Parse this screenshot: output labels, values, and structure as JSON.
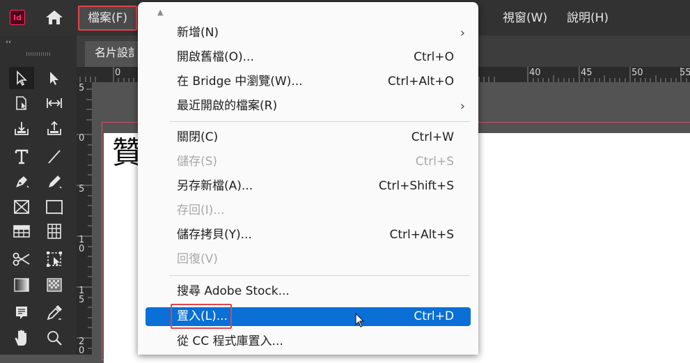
{
  "app": {
    "logo_text": "Id"
  },
  "menubar": {
    "file": "檔案(F)",
    "partial": ")",
    "view": "視窗(W)",
    "help": "說明(H)"
  },
  "toolpanel": {
    "collapse": "‹‹"
  },
  "document": {
    "tab_label": "名片設訁"
  },
  "rulers": {
    "horizontal": [
      "0",
      "40",
      "45",
      "50",
      "55"
    ],
    "vertical": [
      "5",
      "0",
      "5",
      "1\n0",
      "1\n5",
      "2\n0"
    ]
  },
  "page": {
    "glyph": "贊"
  },
  "file_menu": {
    "items": [
      {
        "label": "新增(N)",
        "shortcut": "",
        "submenu": true,
        "disabled": false
      },
      {
        "label": "開啟舊檔(O)...",
        "shortcut": "Ctrl+O",
        "submenu": false,
        "disabled": false
      },
      {
        "label": "在 Bridge 中瀏覽(W)...",
        "shortcut": "Ctrl+Alt+O",
        "submenu": false,
        "disabled": false
      },
      {
        "label": "最近開啟的檔案(R)",
        "shortcut": "",
        "submenu": true,
        "disabled": false
      },
      {
        "label": "關閉(C)",
        "shortcut": "Ctrl+W",
        "submenu": false,
        "disabled": false
      },
      {
        "label": "儲存(S)",
        "shortcut": "Ctrl+S",
        "submenu": false,
        "disabled": true
      },
      {
        "label": "另存新檔(A)...",
        "shortcut": "Ctrl+Shift+S",
        "submenu": false,
        "disabled": false
      },
      {
        "label": "存回(I)...",
        "shortcut": "",
        "submenu": false,
        "disabled": true
      },
      {
        "label": "儲存拷貝(Y)...",
        "shortcut": "Ctrl+Alt+S",
        "submenu": false,
        "disabled": false
      },
      {
        "label": "回復(V)",
        "shortcut": "",
        "submenu": false,
        "disabled": true
      },
      {
        "label": "搜尋 Adobe Stock...",
        "shortcut": "",
        "submenu": false,
        "disabled": false
      },
      {
        "label": "置入(L)...",
        "shortcut": "Ctrl+D",
        "submenu": false,
        "disabled": false
      },
      {
        "label": "從 CC 程式庫置入...",
        "shortcut": "",
        "submenu": false,
        "disabled": false
      }
    ]
  },
  "colors": {
    "highlight": "#0a6fd6",
    "annotation_red": "#e0454d",
    "menubar": "#323232"
  }
}
